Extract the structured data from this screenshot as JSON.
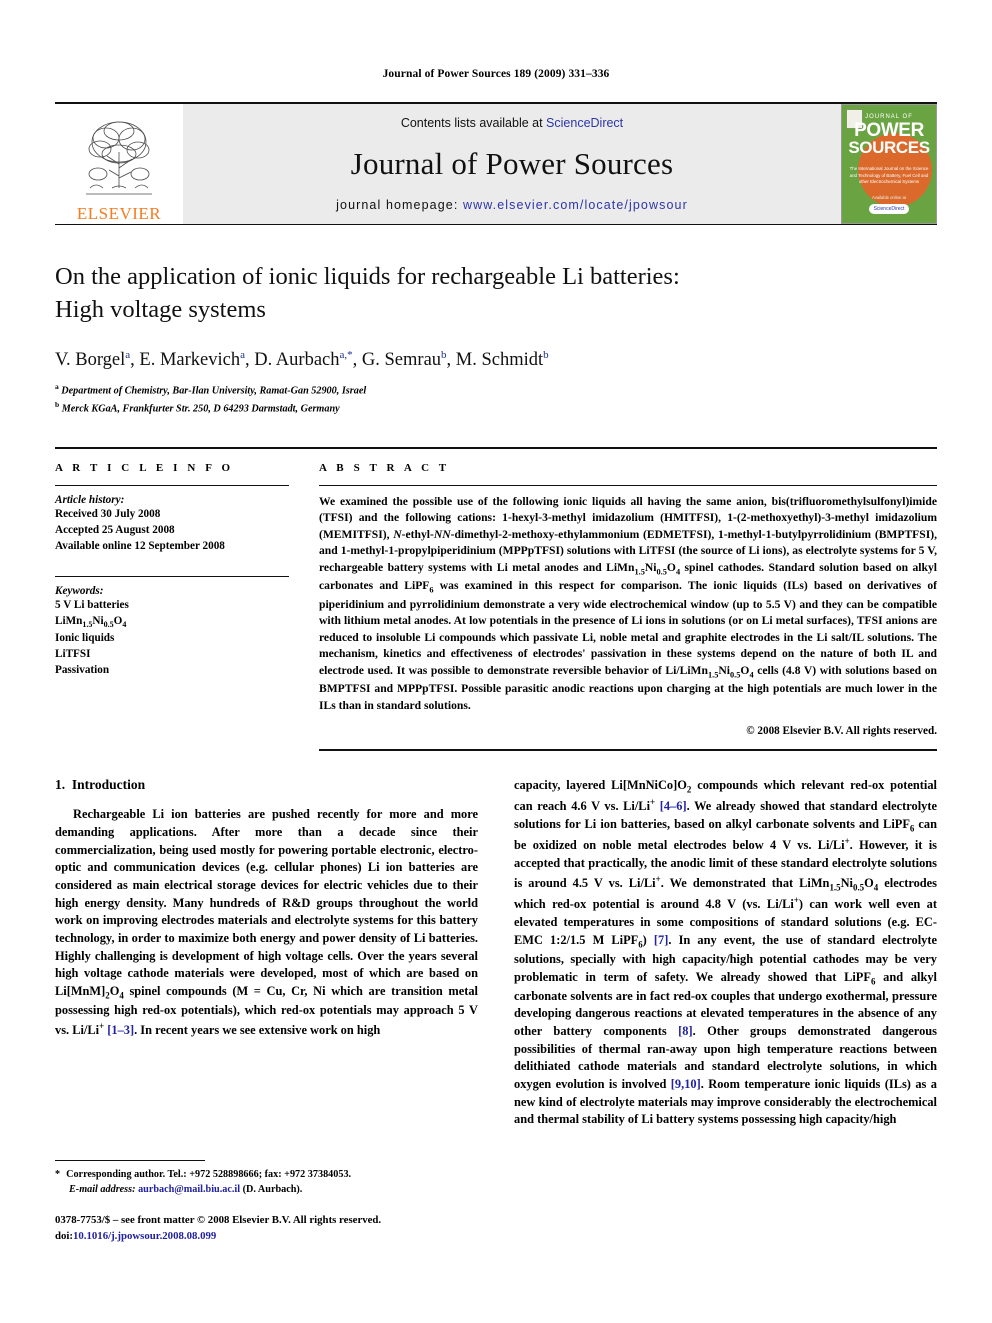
{
  "running_head": "Journal of Power Sources 189 (2009) 331–336",
  "masthead": {
    "publisher_name": "ELSEVIER",
    "contents_prefix": "Contents lists available at ",
    "sciencedirect": "ScienceDirect",
    "journal_title": "Journal of Power Sources",
    "homepage_prefix": "journal homepage: ",
    "homepage_url": "www.elsevier.com/locate/jpowsour",
    "cover": {
      "top_label": "JOURNAL OF",
      "word1": "POWER",
      "word2": "SOURCES",
      "subtitle": "The International Journal on the Science and Technology of Battery, Fuel Cell and other Electrochemical Systems",
      "footer_label": "Available online at",
      "badge": "ScienceDirect"
    },
    "accent_orange": "#F57C20",
    "link_blue": "#2d36a8",
    "cover_green": "#6aa442"
  },
  "article": {
    "title_line1": "On the application of ionic liquids for rechargeable Li batteries:",
    "title_line2": "High voltage systems",
    "authors": "V. Borgel a, E. Markevich a, D. Aurbach a,*, G. Semrau b, M. Schmidt b",
    "affiliation_a": "Department of Chemistry, Bar-Ilan University, Ramat-Gan 52900, Israel",
    "affiliation_b": "Merck KGaA, Frankfurter Str. 250, D 64293 Darmstadt, Germany"
  },
  "info": {
    "heading": "A R T I C L E   I N F O",
    "history_heading": "Article history:",
    "history": [
      "Received 30 July 2008",
      "Accepted 25 August 2008",
      "Available online 12 September 2008"
    ],
    "keywords_heading": "Keywords:",
    "keywords": [
      "5 V Li batteries",
      "LiMn1.5Ni0.5O4",
      "Ionic liquids",
      "LiTFSI",
      "Passivation"
    ]
  },
  "abstract": {
    "heading": "A B S T R A C T",
    "text": "We examined the possible use of the following ionic liquids all having the same anion, bis(trifluoromethylsulfonyl)imide (TFSI) and the following cations: 1-hexyl-3-methyl imidazolium (HMITFSI), 1-(2-methoxyethyl)-3-methyl imidazolium (MEMITFSI), N-ethyl-NN-dimethyl-2-methoxy-ethylammonium (EDMETFSI), 1-methyl-1-butylpyrrolidinium (BMPTFSI), and 1-methyl-1-propylpiperidinium (MPPpTFSI) solutions with LiTFSI (the source of Li ions), as electrolyte systems for 5 V, rechargeable battery systems with Li metal anodes and LiMn1.5Ni0.5O4 spinel cathodes. Standard solution based on alkyl carbonates and LiPF6 was examined in this respect for comparison. The ionic liquids (ILs) based on derivatives of piperidinium and pyrrolidinium demonstrate a very wide electrochemical window (up to 5.5 V) and they can be compatible with lithium metal anodes. At low potentials in the presence of Li ions in solutions (or on Li metal surfaces), TFSI anions are reduced to insoluble Li compounds which passivate Li, noble metal and graphite electrodes in the Li salt/IL solutions. The mechanism, kinetics and effectiveness of electrodes' passivation in these systems depend on the nature of both IL and electrode used. It was possible to demonstrate reversible behavior of Li/LiMn1.5Ni0.5O4 cells (4.8 V) with solutions based on BMPTFSI and MPPpTFSI. Possible parasitic anodic reactions upon charging at the high potentials are much lower in the ILs than in standard solutions.",
    "copyright": "© 2008 Elsevier B.V. All rights reserved."
  },
  "introduction": {
    "number": "1.",
    "heading": "Introduction",
    "paragraph_left": "Rechargeable Li ion batteries are pushed recently for more and more demanding applications. After more than a decade since their commercialization, being used mostly for powering portable electronic, electro-optic and communication devices (e.g. cellular phones) Li ion batteries are considered as main electrical storage devices for electric vehicles due to their high energy density. Many hundreds of R&D groups throughout the world work on improving electrodes materials and electrolyte systems for this battery technology, in order to maximize both energy and power density of Li batteries. Highly challenging is development of high voltage cells. Over the years several high voltage cathode materials were developed, most of which are based on Li[MnM]2O4 spinel compounds (M = Cu, Cr, Ni which are transition metal possessing high red-ox potentials), which red-ox potentials may approach 5 V vs. Li/Li+ [1–3]. In recent years we see extensive work on high",
    "paragraph_right": "capacity, layered Li[MnNiCo]O2 compounds which relevant red-ox potential can reach 4.6 V vs. Li/Li+ [4–6]. We already showed that standard electrolyte solutions for Li ion batteries, based on alkyl carbonate solvents and LiPF6 can be oxidized on noble metal electrodes below 4 V vs. Li/Li+. However, it is accepted that practically, the anodic limit of these standard electrolyte solutions is around 4.5 V vs. Li/Li+. We demonstrated that LiMn1.5Ni0.5O4 electrodes which red-ox potential is around 4.8 V (vs. Li/Li+) can work well even at elevated temperatures in some compositions of standard solutions (e.g. EC-EMC 1:2/1.5 M LiPF6) [7]. In any event, the use of standard electrolyte solutions, specially with high capacity/high potential cathodes may be very problematic in term of safety. We already showed that LiPF6 and alkyl carbonate solvents are in fact red-ox couples that undergo exothermal, pressure developing dangerous reactions at elevated temperatures in the absence of any other battery components [8]. Other groups demonstrated dangerous possibilities of thermal ran-away upon high temperature reactions between delithiated cathode materials and standard electrolyte solutions, in which oxygen evolution is involved [9,10]. Room temperature ionic liquids (ILs) as a new kind of electrolyte materials may improve considerably the electrochemical and thermal stability of Li battery systems possessing high capacity/high"
  },
  "footnotes": {
    "star": "*",
    "corresponding": "Corresponding author. Tel.: +972 528898666; fax: +972 37384053.",
    "email_label": "E-mail address:",
    "email": "aurbach@mail.biu.ac.il",
    "email_suffix": "(D. Aurbach)."
  },
  "footer": {
    "front_matter": "0378-7753/$ – see front matter © 2008 Elsevier B.V. All rights reserved.",
    "doi_label": "doi:",
    "doi": "10.1016/j.jpowsour.2008.08.099"
  }
}
